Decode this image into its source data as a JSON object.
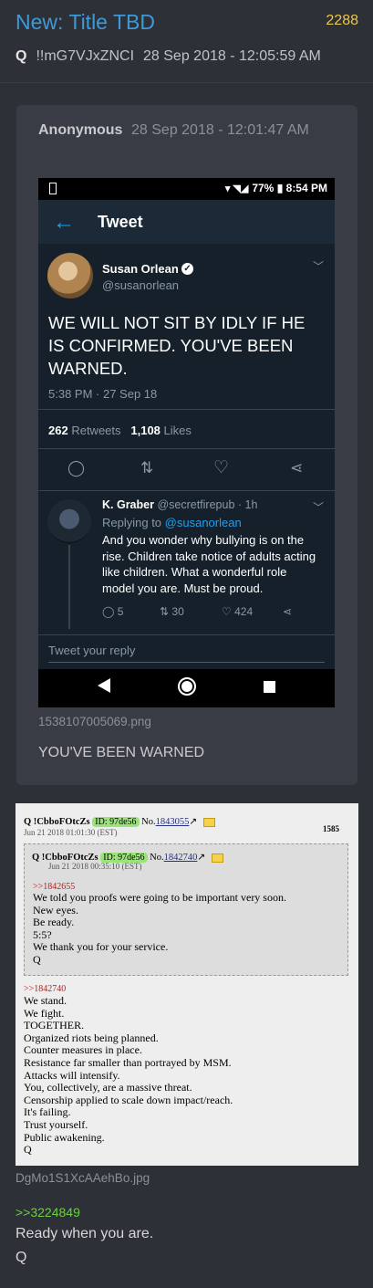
{
  "post": {
    "title": "New: Title TBD",
    "number": "2288",
    "author": "Q",
    "tripcode": "!!mG7VJxZNCI",
    "timestamp": "28 Sep 2018 - 12:05:59 AM"
  },
  "quoted": {
    "author": "Anonymous",
    "timestamp": "28 Sep 2018 - 12:01:47 AM",
    "image_filename": "1538107005069.png",
    "caption": "YOU'VE BEEN WARNED"
  },
  "tweet": {
    "status_bar": {
      "battery": "77%",
      "time": "8:54 PM"
    },
    "header_title": "Tweet",
    "author_name": "Susan Orlean",
    "author_handle": "@susanorlean",
    "text": "WE WILL NOT SIT BY IDLY IF HE IS CONFIRMED. YOU'VE BEEN WARNED.",
    "time": "5:38 PM · 27 Sep 18",
    "retweets": "262",
    "retweets_label": "Retweets",
    "likes": "1,108",
    "likes_label": "Likes",
    "reply": {
      "name": "K. Graber",
      "handle": "@secretfirepub · 1h",
      "replying_to_label": "Replying to",
      "replying_to_handle": "@susanorlean",
      "text": "And you wonder why bullying is on the rise.  Children take notice of adults acting like children.  What a wonderful role model you are.  Must be proud.",
      "replies": "5",
      "retweets": "30",
      "likes": "424"
    },
    "reply_placeholder": "Tweet your reply"
  },
  "chan": {
    "header_trip": "Q !CbboFOtcZs",
    "header_id": "ID: 97de56",
    "header_no_label": "No.",
    "header_no": "1843055",
    "header_date": "Jun 21 2018 01:01:30 (EST)",
    "count": "1585",
    "inner_trip": "Q !CbboFOtcZs",
    "inner_id": "ID: 97de56",
    "inner_no_label": "No.",
    "inner_no": "1842740",
    "inner_date": "Jun 21 2018 00:35:10 (EST)",
    "inner_ref": ">>1842655",
    "inner_lines": "We told you proofs were going to be important very soon.\nNew eyes.\nBe ready.\n5:5?\nWe thank you for your service.\nQ",
    "ref": ">>1842740",
    "lines": "We stand.\nWe fight.\nTOGETHER.\nOrganized riots being planned.\nCounter measures in place.\nResistance far smaller than portrayed by MSM.\nAttacks will intensify.\nYou, collectively, are a massive threat.\nCensorship applied to scale down impact/reach.\nIt's failing.\nTrust yourself.\nPublic awakening.\nQ"
  },
  "chan_image_filename": "DgMo1S1XcAAehBo.jpg",
  "reply_link": ">>3224849",
  "body": {
    "line1": "Ready when you are.",
    "line2": "Q"
  },
  "colors": {
    "title": "#3d9ad9",
    "post_number": "#ecc74a",
    "link_green": "#6ccf3f",
    "twitter_blue": "#1da1f2"
  }
}
